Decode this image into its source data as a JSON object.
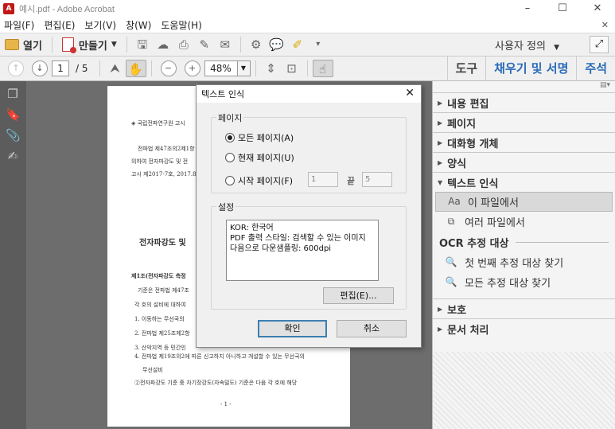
{
  "window": {
    "title": "예시.pdf - Adobe Acrobat",
    "app_icon": "acrobat-icon"
  },
  "menu": [
    "파일(F)",
    "편집(E)",
    "보기(V)",
    "창(W)",
    "도움말(H)"
  ],
  "toolbar": {
    "open_label": "열기",
    "create_label": "만들기",
    "customize_label": "사용자 정의"
  },
  "nav": {
    "page_current": "1",
    "page_total": "/ 5",
    "zoom": "48%"
  },
  "right_tabs": [
    "도구",
    "채우기 및 서명",
    "주석"
  ],
  "document": {
    "lines": [
      "◈ 국립전파연구원 고시",
      "전파법 제47조의2제1항",
      "의하여 전자파강도 및 전",
      "고시 제2017-7호, 2017.8.",
      "전자파강도 및",
      "제1조(전자파강도 측정",
      "기준은 전파법 제47조",
      "각 호의 설비에 대하여",
      "1. 이동하는 무선국의",
      "2. 전파법 제25조제2항",
      "3. 산악지역 등 민간인",
      "4. 전파법 제19조의2에 따른 신고하지 아니하고 개설할 수 있는 무선국의",
      "무선설비",
      "②전자파강도 기준 중 자기장강도(자속밀도) 기준은 다음 각 호에 해당",
      "- 1 -"
    ]
  },
  "right_panel": {
    "sections_top": [
      "내용 편집",
      "페이지",
      "대화형 개체",
      "양식",
      "텍스트 인식"
    ],
    "items": [
      "이 파일에서",
      "여러 파일에서"
    ],
    "ocr_header": "OCR 추정 대상",
    "ocr_items": [
      "첫 번째 추정 대상 찾기",
      "모든 추정 대상 찾기"
    ],
    "sections_bottom": [
      "보호",
      "문서 처리"
    ]
  },
  "dialog": {
    "title": "텍스트 인식",
    "page_group": "페이지",
    "radio_all": "모든 페이지(A)",
    "radio_current": "현재 페이지(U)",
    "radio_from": "시작 페이지(F)",
    "from_value": "1",
    "to_label": "끝",
    "to_value": "5",
    "settings_group": "설정",
    "settings_lines": [
      "KOR: 한국어",
      "PDF 출력 스타일: 검색할 수 있는 이미지",
      "다음으로 다운샘플링: 600dpi"
    ],
    "edit_button": "편집(E)...",
    "ok_button": "확인",
    "cancel_button": "취소"
  }
}
